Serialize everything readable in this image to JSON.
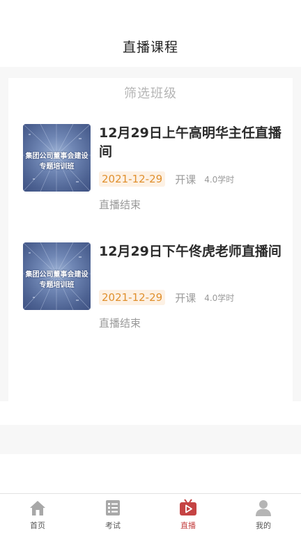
{
  "header": {
    "title": "直播课程"
  },
  "filter": {
    "label": "筛选班级"
  },
  "courses": [
    {
      "title": "12月29日上午高明华主任直播间",
      "thumb_line1": "集团公司董事会建设",
      "thumb_line2": "专题培训班",
      "date": "2021-12-29",
      "open_label": "开课",
      "hours": "4.0学时",
      "status": "直播结束"
    },
    {
      "title": "12月29日下午佟虎老师直播间",
      "thumb_line1": "集团公司董事会建设",
      "thumb_line2": "专题培训班",
      "date": "2021-12-29",
      "open_label": "开课",
      "hours": "4.0学时",
      "status": "直播结束"
    }
  ],
  "tabbar": {
    "items": [
      {
        "label": "首页",
        "icon": "home-icon"
      },
      {
        "label": "考试",
        "icon": "exam-icon"
      },
      {
        "label": "直播",
        "icon": "live-icon",
        "active": true
      },
      {
        "label": "我的",
        "icon": "user-icon"
      }
    ]
  },
  "colors": {
    "accent": "#c54343",
    "date_badge_text": "#e0902e",
    "date_badge_bg": "#fdf1e4"
  }
}
